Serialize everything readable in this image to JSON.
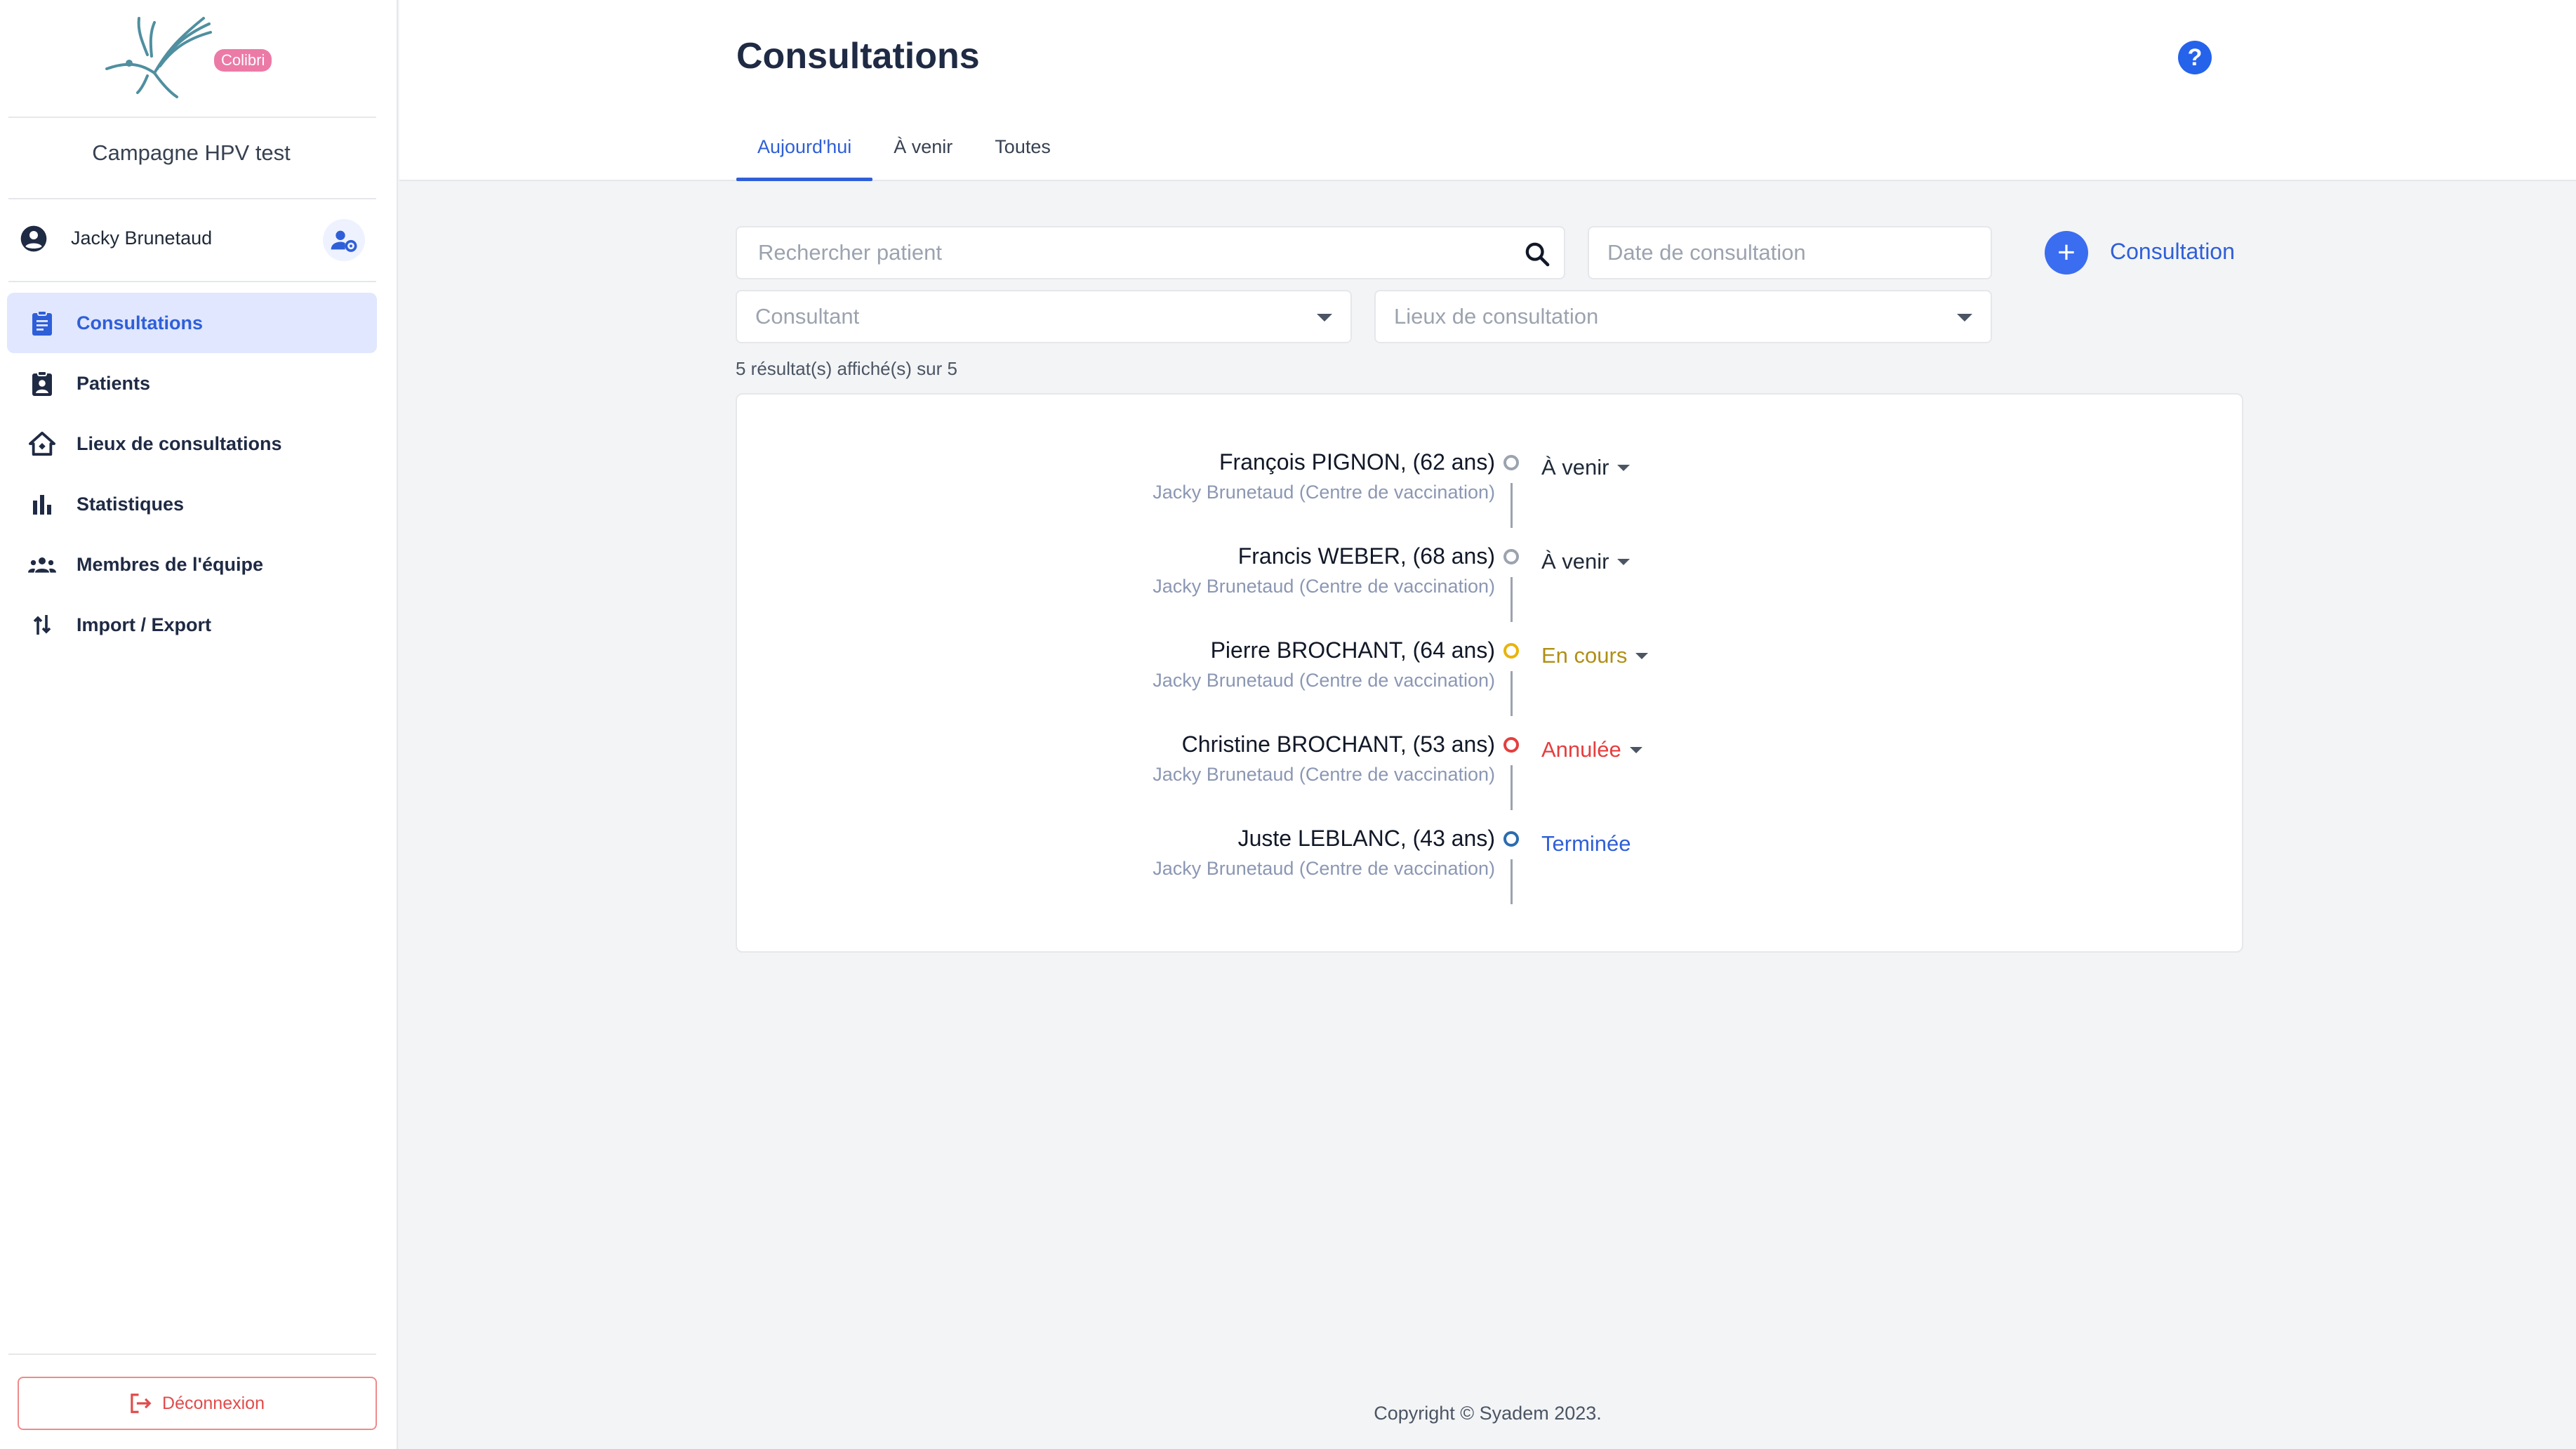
{
  "sidebar": {
    "logo_badge": "Colibri",
    "campaign": "Campagne HPV test",
    "user_name": "Jacky Brunetaud",
    "items": [
      {
        "label": "Consultations",
        "icon": "clipboard-icon",
        "active": true
      },
      {
        "label": "Patients",
        "icon": "patient-badge-icon",
        "active": false
      },
      {
        "label": "Lieux de consultations",
        "icon": "home-icon",
        "active": false
      },
      {
        "label": "Statistiques",
        "icon": "bar-chart-icon",
        "active": false
      },
      {
        "label": "Membres de l'équipe",
        "icon": "team-icon",
        "active": false
      },
      {
        "label": "Import / Export",
        "icon": "swap-vertical-icon",
        "active": false
      }
    ],
    "logout_label": "Déconnexion"
  },
  "header": {
    "title": "Consultations",
    "help_glyph": "?",
    "tabs": [
      "Aujourd'hui",
      "À venir",
      "Toutes"
    ],
    "active_tab": 0
  },
  "filters": {
    "search_placeholder": "Rechercher patient",
    "date_placeholder": "Date de consultation",
    "consultant_placeholder": "Consultant",
    "lieux_placeholder": "Lieux de consultation",
    "add_label": "Consultation"
  },
  "results_text": "5 résultat(s) affiché(s) sur 5",
  "consultations": [
    {
      "name": "François PIGNON, (62 ans)",
      "sub": "Jacky Brunetaud (Centre de vaccination)",
      "status": "À venir",
      "color": "#9ca3af",
      "text_color": "#1f2937",
      "dropdown": true
    },
    {
      "name": "Francis WEBER, (68 ans)",
      "sub": "Jacky Brunetaud (Centre de vaccination)",
      "status": "À venir",
      "color": "#9ca3af",
      "text_color": "#1f2937",
      "dropdown": true
    },
    {
      "name": "Pierre BROCHANT, (64 ans)",
      "sub": "Jacky Brunetaud (Centre de vaccination)",
      "status": "En cours",
      "color": "#eab308",
      "text_color": "#b08f15",
      "dropdown": true
    },
    {
      "name": "Christine BROCHANT, (53 ans)",
      "sub": "Jacky Brunetaud (Centre de vaccination)",
      "status": "Annulée",
      "color": "#e53e3e",
      "text_color": "#e53e3e",
      "dropdown": true
    },
    {
      "name": "Juste LEBLANC, (43 ans)",
      "sub": "Jacky Brunetaud (Centre de vaccination)",
      "status": "Terminée",
      "color": "#2b6cb0",
      "text_color": "#2f5fd8",
      "dropdown": false
    }
  ],
  "footer": "Copyright © Syadem 2023."
}
